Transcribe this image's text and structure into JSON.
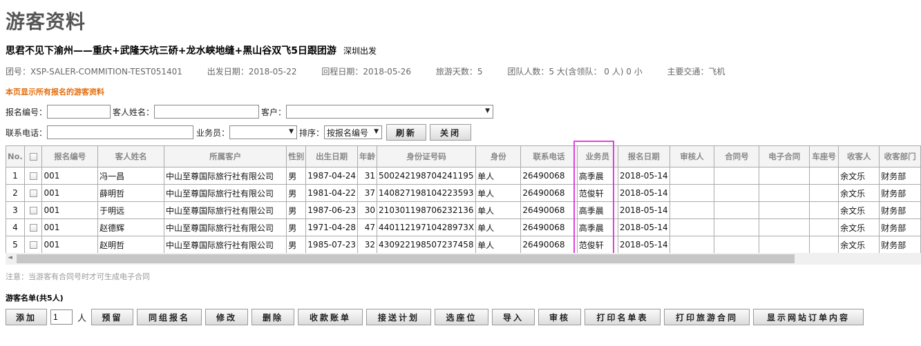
{
  "page": {
    "title": "游客资料"
  },
  "tour": {
    "name": "思君不见下渝州——重庆+武隆天坑三硚+龙水峡地缝+黑山谷双飞5日跟团游",
    "departure_city": "深圳出发"
  },
  "meta": {
    "group_no": "团号：XSP-SALER-COMMITION-TEST051401",
    "depart_date": "出发日期：2018-05-22",
    "return_date": "回程日期：2018-05-26",
    "days": "旅游天数：5",
    "people": "团队人数：5 大(含领队： 0 人) 0 小",
    "transport": "主要交通：飞机"
  },
  "notice": "本页显示所有报名的游客资料",
  "filters": {
    "reg_no_label": "报名编号：",
    "name_label": "客人姓名：",
    "customer_label": "客户：",
    "phone_label": "联系电话：",
    "salesman_label": "业务员：",
    "sort_label": "排序：",
    "sort_value": "按报名编号",
    "refresh": "刷新",
    "close": "关闭"
  },
  "table": {
    "headers": [
      "No.",
      "",
      "报名编号",
      "客人姓名",
      "所属客户",
      "性别",
      "出生日期",
      "年龄",
      "身份证号码",
      "身份",
      "联系电话",
      "业务员",
      "报名日期",
      "审核人",
      "合同号",
      "电子合同",
      "车座号",
      "收客人",
      "收客部门"
    ],
    "rows": [
      [
        "1",
        "",
        "001",
        "冯一昌",
        "中山至尊国际旅行社有限公司",
        "男",
        "1987-04-24",
        "31",
        "500242198704241195",
        "单人",
        "26490068",
        "高季晨",
        "2018-05-14",
        "",
        "",
        "",
        "",
        "余文乐",
        "财务部"
      ],
      [
        "2",
        "",
        "001",
        "薛明哲",
        "中山至尊国际旅行社有限公司",
        "男",
        "1981-04-22",
        "37",
        "140827198104223593",
        "单人",
        "26490068",
        "范俊轩",
        "2018-05-14",
        "",
        "",
        "",
        "",
        "余文乐",
        "财务部"
      ],
      [
        "3",
        "",
        "001",
        "于明远",
        "中山至尊国际旅行社有限公司",
        "男",
        "1987-06-23",
        "30",
        "210301198706232136",
        "单人",
        "26490068",
        "高季晨",
        "2018-05-14",
        "",
        "",
        "",
        "",
        "余文乐",
        "财务部"
      ],
      [
        "4",
        "",
        "001",
        "赵德辉",
        "中山至尊国际旅行社有限公司",
        "男",
        "1971-04-28",
        "47",
        "44011219710428973X",
        "单人",
        "26490068",
        "高季晨",
        "2018-05-14",
        "",
        "",
        "",
        "",
        "余文乐",
        "财务部"
      ],
      [
        "5",
        "",
        "001",
        "赵明哲",
        "中山至尊国际旅行社有限公司",
        "男",
        "1985-07-23",
        "32",
        "430922198507237458",
        "单人",
        "26490068",
        "范俊轩",
        "2018-05-14",
        "",
        "",
        "",
        "",
        "余文乐",
        "财务部"
      ]
    ]
  },
  "footer": {
    "note": "注意：当游客有合同号时才可生成电子合同",
    "roster": "游客名单(共5人)",
    "qty_value": "1",
    "unit": "人",
    "buttons": [
      "添加",
      "预留",
      "同组报名",
      "修改",
      "删除",
      "收款账单",
      "接送计划",
      "选座位",
      "导入",
      "审核",
      "打印名单表",
      "打印旅游合同",
      "显示网站订单内容"
    ]
  },
  "colors": {
    "highlight": "#e040e0",
    "notice": "#e46c0a"
  }
}
